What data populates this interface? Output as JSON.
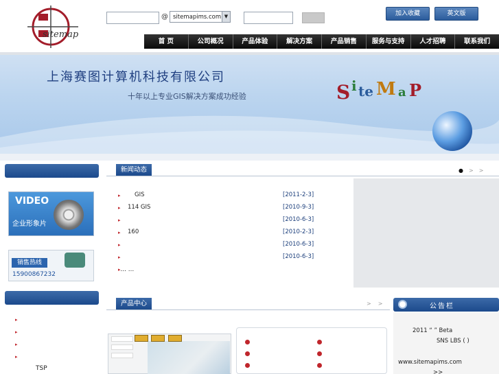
{
  "header": {
    "at_sign": "@",
    "mail_domain": "sitemapims.com",
    "add_favorite": "加入收藏",
    "english": "英文版"
  },
  "nav": [
    "首 页",
    "公司概况",
    "产品体验",
    "解决方案",
    "产品销售",
    "服务与支持",
    "人才招聘",
    "联系我们"
  ],
  "banner": {
    "company": "上海赛图计算机科技有限公司",
    "tagline": "十年以上专业GIS解决方案成功经验"
  },
  "left": {
    "video_label": "VIDEO",
    "video_sub": "企业形象片",
    "hotline_title": "销售热线",
    "hotline_number": "15900867232",
    "list_tail": "TSP"
  },
  "news": {
    "title": "新闻动态",
    "items": [
      {
        "text": "GIS",
        "date": "[2011-2-3]"
      },
      {
        "text": "114 GIS",
        "date": "[2010-9-3]"
      },
      {
        "text": "",
        "date": "[2010-6-3]"
      },
      {
        "text": "160",
        "date": "[2010-2-3]"
      },
      {
        "text": "",
        "date": "[2010-6-3]"
      },
      {
        "text": "",
        "date": "[2010-6-3]"
      }
    ],
    "more": "… …"
  },
  "products": {
    "title": "产品中心"
  },
  "notice": {
    "title": "公告栏",
    "line1": "2011 “ ” Beta",
    "line2": "SNS LBS ( )",
    "line3": "www.sitemapims.com",
    "line4": ">>"
  }
}
